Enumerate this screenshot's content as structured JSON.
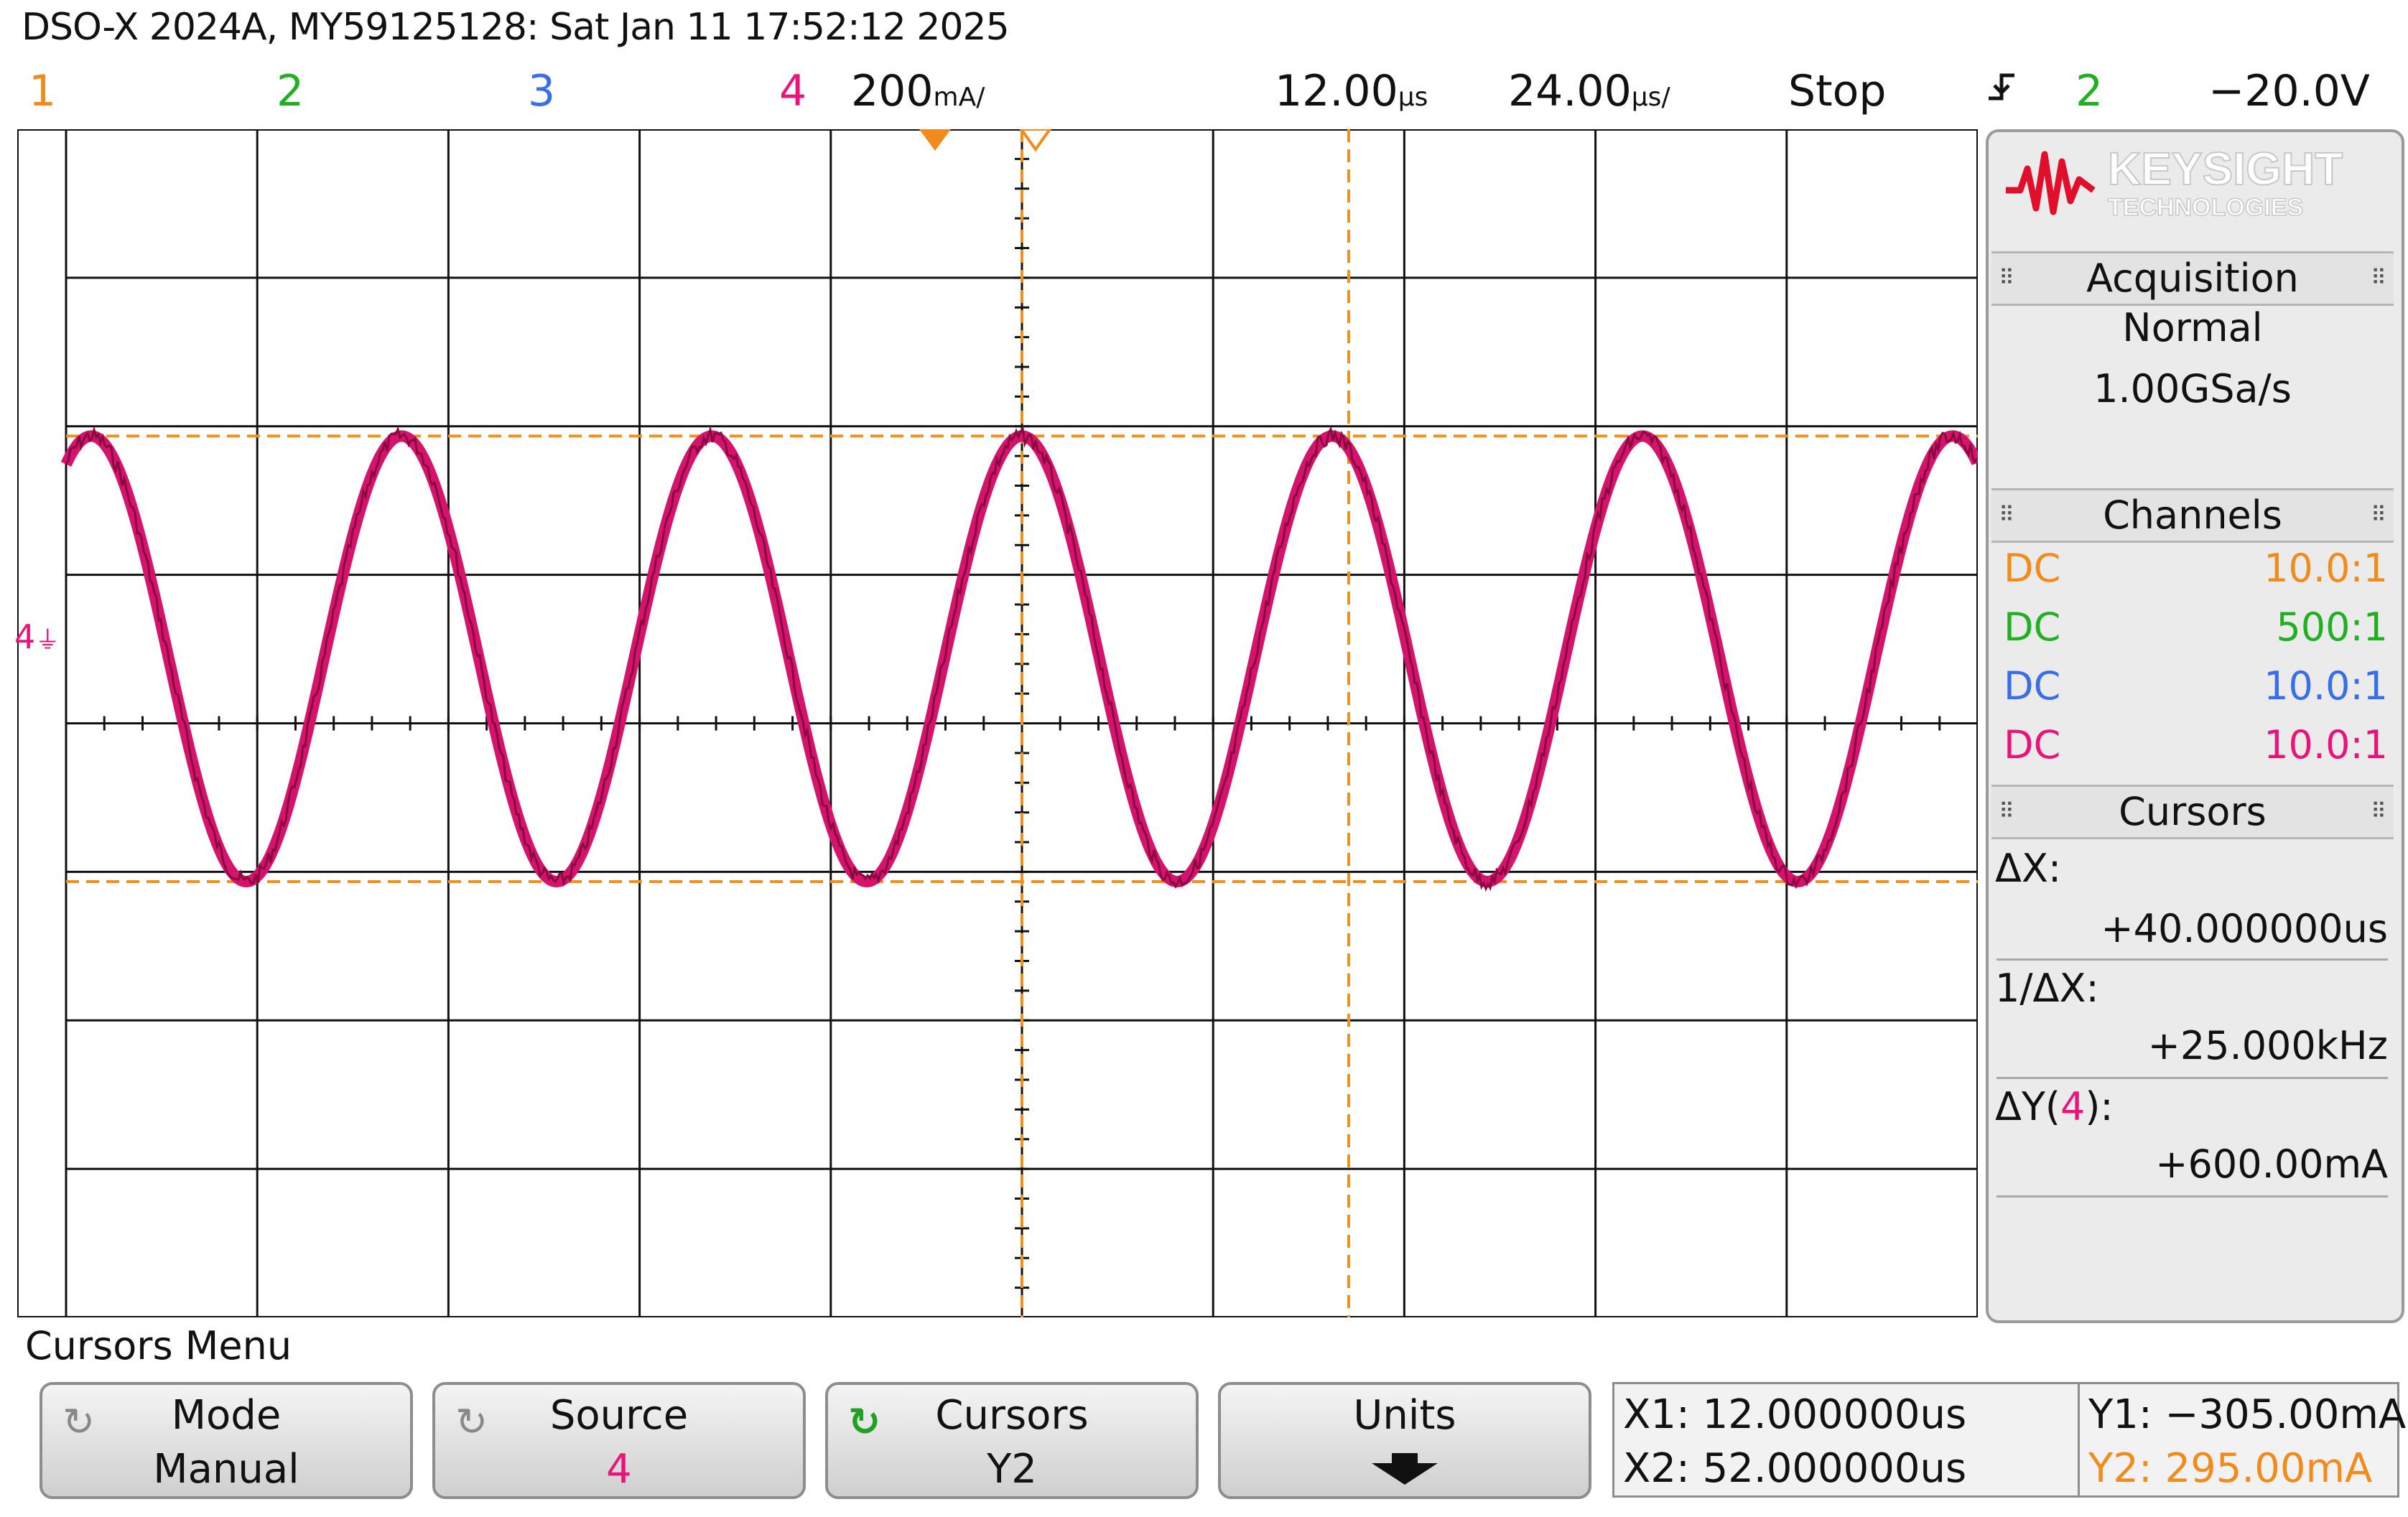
{
  "header": {
    "title": "DSO-X 2024A, MY59125128: Sat Jan 11 17:52:12 2025",
    "ch1": "1",
    "ch2": "2",
    "ch3": "3",
    "ch4": "4",
    "ch4_scale": "200",
    "ch4_scale_unit": "mA/",
    "time_delay": "12.00",
    "time_delay_unit": "µs",
    "time_scale": "24.00",
    "time_scale_unit": "µs/",
    "run_state": "Stop",
    "trigger_slope_icon": "falling-edge-icon",
    "trigger_source": "2",
    "trigger_level": "−20.0V"
  },
  "colors": {
    "ch1": "#f08c1e",
    "ch2": "#22b022",
    "ch3": "#3a6ee8",
    "ch4": "#e8147a",
    "cursor": "#f0901e",
    "trace": "#d4146c"
  },
  "screen": {
    "ground_marker": "4",
    "waveform": {
      "channel": 4,
      "shape": "sine",
      "period_us": 40,
      "amplitude_high_mA": 295,
      "amplitude_low_mA": -305
    }
  },
  "brand": {
    "name": "KEYSIGHT",
    "sub": "TECHNOLOGIES"
  },
  "acquisition": {
    "heading": "Acquisition",
    "mode": "Normal",
    "rate": "1.00GSa/s"
  },
  "channels": {
    "heading": "Channels",
    "rows": [
      {
        "coupling": "DC",
        "probe": "10.0:1"
      },
      {
        "coupling": "DC",
        "probe": "500:1"
      },
      {
        "coupling": "DC",
        "probe": "10.0:1"
      },
      {
        "coupling": "DC",
        "probe": "10.0:1"
      }
    ]
  },
  "cursors": {
    "heading": "Cursors",
    "dx_label": "ΔX:",
    "dx_value": "+40.000000us",
    "inv_dx_label": "1/ΔX:",
    "inv_dx_value": "+25.000kHz",
    "dy_label_pre": "ΔY(",
    "dy_label_ch": "4",
    "dy_label_post": "):",
    "dy_value": "+600.00mA"
  },
  "menu": {
    "title": "Cursors Menu",
    "softkeys": [
      {
        "label": "Mode",
        "value": "Manual"
      },
      {
        "label": "Source",
        "value": "4"
      },
      {
        "label": "Cursors",
        "value": "Y2"
      },
      {
        "label": "Units",
        "value": ""
      }
    ]
  },
  "readout": {
    "x1": "X1: 12.000000us",
    "x2": "X2: 52.000000us",
    "y1": "Y1: −305.00mA",
    "y2": "Y2: 295.00mA"
  }
}
